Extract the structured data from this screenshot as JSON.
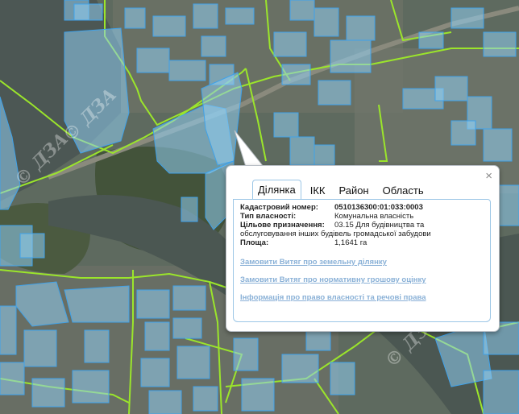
{
  "map": {
    "watermark": "© ДЗА",
    "colors": {
      "parcel_fill": "#8fcdf0",
      "parcel_stroke": "#3fa2ea",
      "boundary": "#9be52b",
      "river": "#4e5955",
      "land": "#5f6a60"
    }
  },
  "popup": {
    "close_label": "×",
    "tabs": [
      "Ділянка",
      "ІКК",
      "Район",
      "Область"
    ],
    "active_tab": 0,
    "fields": {
      "cadastral_label": "Кадастровий номер:",
      "cadastral_value": "0510136300:01:033:0003",
      "ownership_label": "Тип власності:",
      "ownership_value": "Комунальна власність",
      "purpose_label": "Цільове призначення:",
      "purpose_line1": "03.15 Для будівництва та",
      "purpose_line2": "обслуговування інших будівель громадської забудови",
      "area_label": "Площа:",
      "area_value": "1,1641 га"
    },
    "links": [
      "Замовити Витяг про земельну ділянку",
      "Замовити Витяг про нормативну грошову оцінку",
      "Інформація про право власності та речові права"
    ]
  }
}
